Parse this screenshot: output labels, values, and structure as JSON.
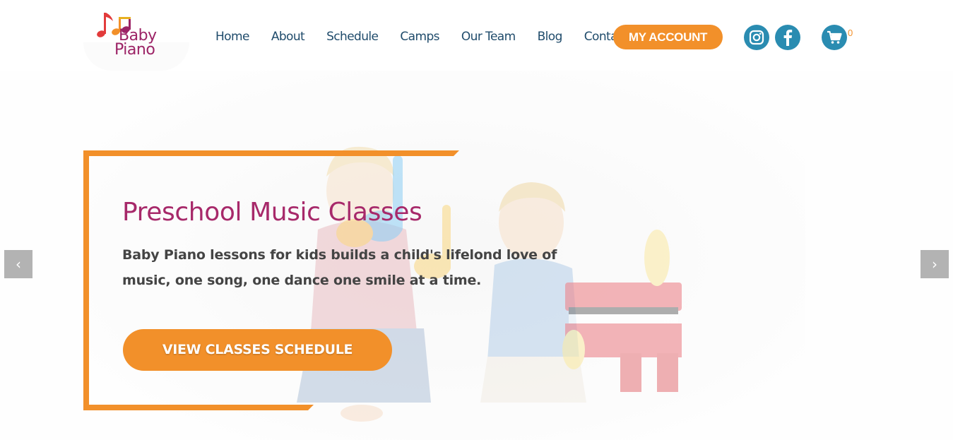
{
  "header": {
    "logo": {
      "line1": "Baby",
      "line2": "Piano"
    },
    "nav": [
      "Home",
      "About",
      "Schedule",
      "Camps",
      "Our Team",
      "Blog",
      "Contact"
    ],
    "account_label": "MY ACCOUNT",
    "social": {
      "instagram_icon": "instagram-icon",
      "facebook_icon": "facebook-icon"
    },
    "cart": {
      "icon": "cart-icon",
      "count": "0"
    }
  },
  "hero": {
    "title": "Preschool Music Classes",
    "text": "Baby Piano lessons for kids builds a child's lifelond love of music, one song, one dance one smile at a time.",
    "cta_label": "VIEW CLASSES SCHEDULE",
    "prev_arrow": "‹",
    "next_arrow": "›"
  },
  "colors": {
    "accent_orange": "#f2902a",
    "brand_magenta": "#a7296a",
    "nav_text": "#1f4b6b",
    "social_blue": "#2a8cb1"
  }
}
